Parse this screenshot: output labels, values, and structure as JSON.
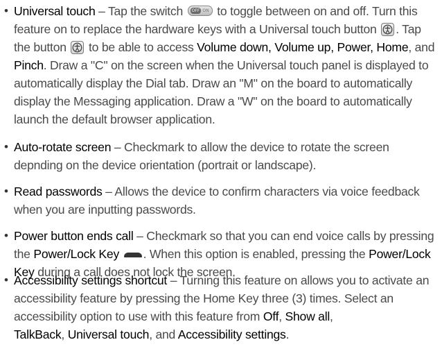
{
  "bullet_char": "•",
  "items": [
    {
      "term": "Universal touch",
      "t1": " – Tap the switch ",
      "switch": {
        "off": "OFF",
        "on": "ON"
      },
      "t2": " to toggle between on and off. Turn this feature on to replace the hardware keys with a Universal touch button ",
      "t3": ". Tap the button ",
      "t4": " to be able to access ",
      "kw1": "Volume down, Volume up,",
      "kw2": "Power, Home",
      "t5": ", and ",
      "kw3": "Pinch",
      "t6": ". Draw a \"C\" on the screen when the Universal touch panel is displayed to automatically display the Dial tab. Draw an \"M\" on the board to automatically display the Messaging application. Draw a \"W\" on the board to automatically launch the default browser application."
    },
    {
      "term": "Auto-rotate screen",
      "text": " – Checkmark to allow the device to rotate the screen depnding on the device orientation (portrait or landscape)."
    },
    {
      "term": "Read passwords",
      "text": " – Allows the device to confirm characters via voice feedback when you are inputting passwords."
    },
    {
      "term": "Power button ends call",
      "t1": " – Checkmark so that you can end voice calls by pressing the ",
      "kw1": "Power/Lock Key",
      "t2": ". When this option is enabled, pressing the ",
      "kw2": "Power/Lock Key",
      "t3": " during a call does not lock the screen."
    },
    {
      "term": "Accessibility settings shortcut",
      "t1": " – Turning this feature on allows you to activate an accessibility feature by pressing the Home Key three (3) times. Select an accessibility option to use with this feature from ",
      "kw1": "Off",
      "t2": ", ",
      "kw2": "Show all",
      "t3": ",",
      "kw3": "TalkBack",
      "t4": ", ",
      "kw4": "Universal touch",
      "t5": ", and ",
      "kw5": "Accessibility settings",
      "t6": "."
    }
  ],
  "icons": {
    "universal_touch_button": "universal-touch-button-icon",
    "switch": "off-on-switch-icon",
    "power_lock_key": "power-lock-key-icon"
  }
}
